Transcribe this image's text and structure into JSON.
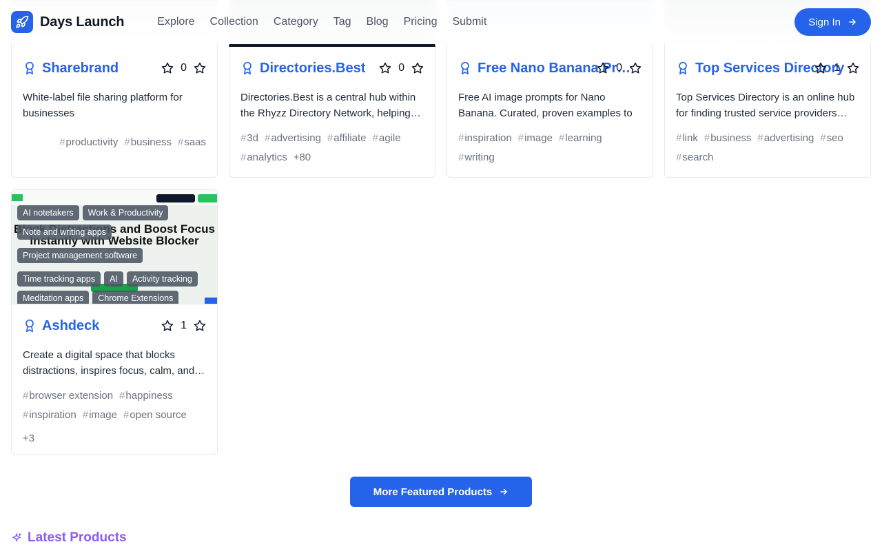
{
  "header": {
    "brand": "Days Launch",
    "nav": [
      "Explore",
      "Collection",
      "Category",
      "Tag",
      "Blog",
      "Pricing",
      "Submit"
    ],
    "signin_label": "Sign In"
  },
  "cards": [
    {
      "title": "Sharebrand",
      "star_count": "0",
      "description": "White-label file sharing platform for businesses",
      "tags": [
        "productivity",
        "business",
        "saas"
      ],
      "more": ""
    },
    {
      "title": "Directories.Best",
      "star_count": "0",
      "description": "Directories.Best is a central hub within the Rhyzz Directory Network, helping…",
      "tags": [
        "3d",
        "advertising",
        "affiliate",
        "agile",
        "analytics"
      ],
      "more": "+80"
    },
    {
      "title": "Free Nano Banana Pro…",
      "star_count": "0",
      "description": "Free AI image prompts for Nano Banana. Curated, proven examples to boost…",
      "tags": [
        "inspiration",
        "image",
        "learning",
        "writing"
      ],
      "more": ""
    },
    {
      "title": "Top Services Directory",
      "star_count": "1",
      "description": "Top Services Directory is an online hub for finding trusted service providers…",
      "tags": [
        "link",
        "business",
        "advertising",
        "seo",
        "search"
      ],
      "more": ""
    }
  ],
  "ashdeck": {
    "title": "Ashdeck",
    "star_count": "1",
    "description": "Create a digital space that blocks distractions, inspires focus, calm, and…",
    "image_headline": "Block Distractions and Boost Focus Instantly with Website Blocker",
    "categories": [
      "AI notetakers",
      "Work & Productivity",
      "Note and writing apps",
      "Project management software",
      "Time tracking apps",
      "AI",
      "Activity tracking",
      "Meditation apps",
      "Chrome Extensions"
    ],
    "tags": [
      "browser extension",
      "happiness",
      "inspiration",
      "image",
      "open source"
    ],
    "more": "+3"
  },
  "more_button_label": "More Featured Products",
  "latest_title": "Latest Products",
  "colors": {
    "accent": "#2563eb",
    "latest": "#8b5cf6"
  }
}
